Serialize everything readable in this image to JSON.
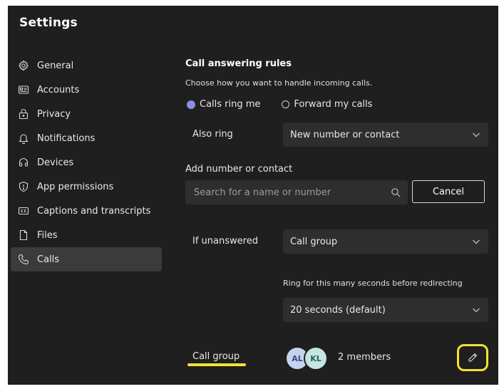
{
  "app": {
    "title": "Settings"
  },
  "sidebar": {
    "items": [
      {
        "label": "General",
        "icon": "gear-icon"
      },
      {
        "label": "Accounts",
        "icon": "id-card-icon"
      },
      {
        "label": "Privacy",
        "icon": "lock-icon"
      },
      {
        "label": "Notifications",
        "icon": "bell-icon"
      },
      {
        "label": "Devices",
        "icon": "headset-icon"
      },
      {
        "label": "App permissions",
        "icon": "shield-icon"
      },
      {
        "label": "Captions and transcripts",
        "icon": "captions-icon"
      },
      {
        "label": "Files",
        "icon": "file-icon"
      },
      {
        "label": "Calls",
        "icon": "phone-icon",
        "active": true
      }
    ]
  },
  "calls": {
    "section_title": "Call answering rules",
    "description": "Choose how you want to handle incoming calls.",
    "radio_ring_me": "Calls ring me",
    "radio_forward": "Forward my calls",
    "selected_radio": "Calls ring me",
    "also_ring_label": "Also ring",
    "also_ring_value": "New number or contact",
    "add_contact_label": "Add number or contact",
    "search_placeholder": "Search for a name or number",
    "cancel_label": "Cancel",
    "if_unanswered_label": "If unanswered",
    "if_unanswered_value": "Call group",
    "ring_caption": "Ring for this many seconds before redirecting",
    "ring_value": "20 seconds (default)",
    "call_group_label": "Call group",
    "avatar_1": "AL",
    "avatar_2": "KL",
    "members_text": "2 members"
  },
  "colors": {
    "background": "#1f1f1f",
    "accent_radio": "#8b8fe8",
    "highlight": "#f4e234",
    "active_nav": "#3b3b3b",
    "dropdown_bg": "#2e2e2e"
  }
}
